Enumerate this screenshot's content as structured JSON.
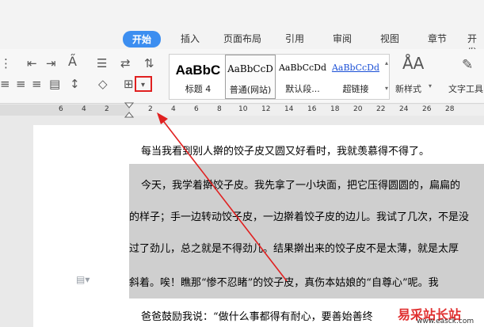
{
  "tabs": [
    {
      "label": "开始",
      "active": true
    },
    {
      "label": "插入"
    },
    {
      "label": "页面布局"
    },
    {
      "label": "引用"
    },
    {
      "label": "审阅"
    },
    {
      "label": "视图"
    },
    {
      "label": "章节"
    },
    {
      "label": "开发"
    }
  ],
  "styles": {
    "items": [
      {
        "preview": "AaBbC",
        "label": "标题 4"
      },
      {
        "preview": "AaBbCcD",
        "label": "普通(网站)"
      },
      {
        "preview": "AaBbCcDd",
        "label": "默认段..."
      },
      {
        "preview": "AaBbCcDd",
        "label": "超链接"
      }
    ],
    "new_style": "新样式",
    "text_tools": "文字工具"
  },
  "ruler": {
    "numbers": [
      "6",
      "4",
      "2",
      "2",
      "4",
      "6",
      "8",
      "10",
      "12",
      "14",
      "16",
      "18",
      "20",
      "22",
      "24",
      "26",
      "28"
    ]
  },
  "document": {
    "lines": [
      "每当我看到别人擀的饺子皮又圆又好看时，我就羡慕得不得了。",
      "今天，我学着擀饺子皮。我先拿了一小块面，把它压得圆圆的，扁扁的",
      "的样子；手一边转动饺子皮，一边擀着饺子皮的边儿。我试了几次，不是没",
      "过了劲儿，总之就是不得劲儿。结果擀出来的饺子皮不是太薄，就是太厚",
      "斜着。唉！瞧那“惨不忍睹”的饺子皮，真伤本姑娘的“自尊心”呢。我",
      "爸爸鼓励我说：“做什么事都得有耐心，要善始善终"
    ]
  },
  "watermark": {
    "cn": "易采站长站",
    "en": "www.easck.com"
  },
  "colors": {
    "accent": "#3c8ef0",
    "highlight_box": "#e02020",
    "arrow": "#e02020"
  }
}
